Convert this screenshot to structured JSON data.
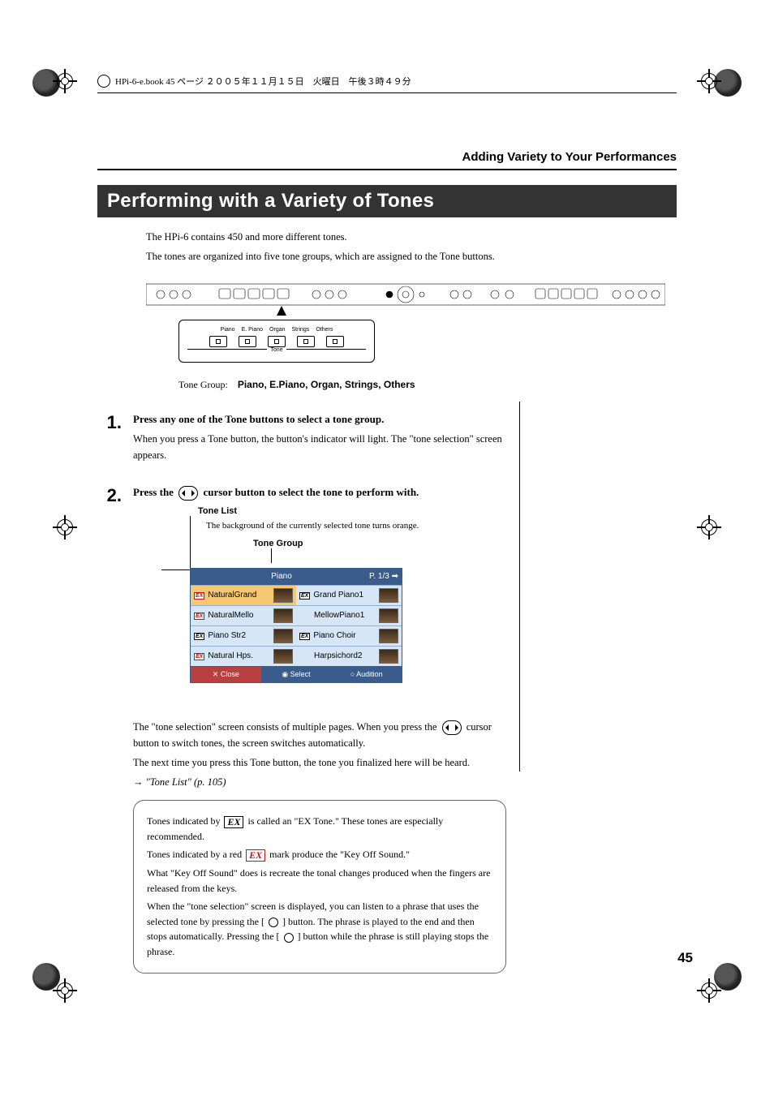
{
  "book_header": "HPi-6-e.book 45 ページ ２００５年１１月１５日　火曜日　午後３時４９分",
  "running_head": "Adding Variety to Your Performances",
  "title": "Performing with a Variety of Tones",
  "intro": {
    "l1": "The HPi-6 contains 450 and more different tones.",
    "l2": "The tones are organized into five tone groups, which are assigned to the Tone buttons."
  },
  "tone_panel": {
    "labels": [
      "Piano",
      "E. Piano",
      "Organ",
      "Strings",
      "Others"
    ],
    "foot": "Tone"
  },
  "tone_group_line": {
    "label": "Tone Group:",
    "value": "Piano, E.Piano, Organ, Strings, Others"
  },
  "steps": {
    "s1": {
      "num": "1.",
      "lead": "Press any one of the Tone buttons to select a tone group.",
      "p1": "When you press a Tone button, the button's indicator will light. The \"tone selection\" screen appears."
    },
    "s2": {
      "num": "2.",
      "lead_pre": "Press the ",
      "lead_post": " cursor button to select the tone to perform with."
    }
  },
  "tone_list": {
    "label_list": "Tone List",
    "label_group": "Tone Group",
    "caption": "The background of the currently selected tone turns orange.",
    "header_center": "Piano",
    "header_right": "P. 1/3 ➡",
    "cells": [
      {
        "ex": "red",
        "name": "NaturalGrand",
        "sel": true
      },
      {
        "ex": "blk",
        "name": "Grand Piano1"
      },
      {
        "ex": "red",
        "name": "NaturalMello"
      },
      {
        "ex": "",
        "name": "MellowPiano1"
      },
      {
        "ex": "blk",
        "name": "Piano Str2"
      },
      {
        "ex": "blk",
        "name": "Piano Choir"
      },
      {
        "ex": "red",
        "name": "Natural Hps."
      },
      {
        "ex": "",
        "name": "Harpsichord2"
      }
    ],
    "footer": [
      "✕ Close",
      "◉ Select",
      "○ Audition"
    ]
  },
  "after_screen": {
    "p1a": "The \"tone selection\" screen consists of multiple pages. When you press the ",
    "p1b": " cursor button to switch tones, the screen switches automatically.",
    "p2": "The next time you press this Tone button, the tone you finalized here will be heard.",
    "ref_arrow": "→",
    "ref": "\"Tone List\" (p. 105)"
  },
  "callout": {
    "p1a": "Tones indicated by ",
    "p1b": " is called an \"EX Tone.\" These tones are especially recommended.",
    "p2a": "Tones indicated by a red ",
    "p2b": " mark produce the \"Key Off Sound.\"",
    "p3": "What \"Key Off Sound\" does is recreate the tonal changes produced when the fingers are released from the keys.",
    "p4a": "When the \"tone selection\" screen is displayed, you can listen to a phrase that uses the selected tone by pressing the [ ",
    "p4b": " ] button. The phrase is played to the end and then stops automatically. Pressing the [ ",
    "p4c": " ] button while the phrase is still playing stops the phrase."
  },
  "ex_label": "EX",
  "page_num": "45"
}
